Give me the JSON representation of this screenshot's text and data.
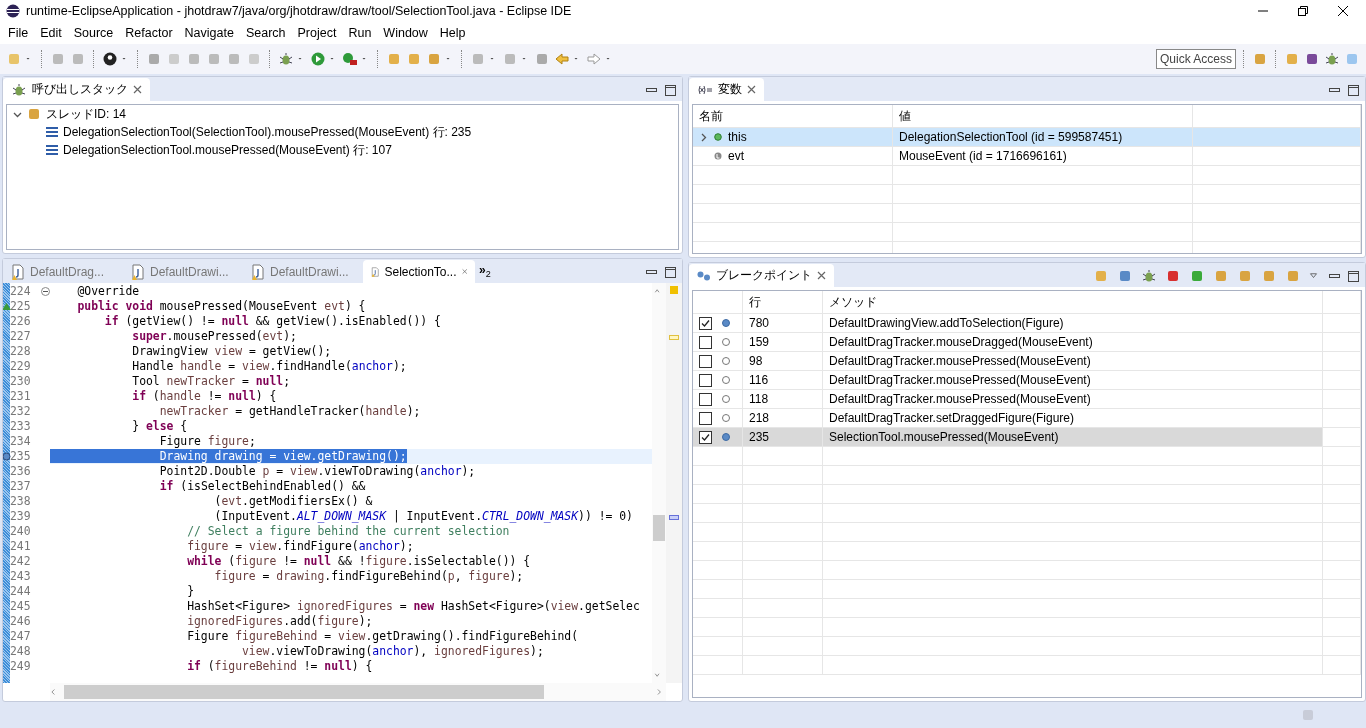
{
  "window": {
    "title": "runtime-EclipseApplication - jhotdraw7/java/org/jhotdraw/draw/tool/SelectionTool.java - Eclipse IDE"
  },
  "menu": [
    "File",
    "Edit",
    "Source",
    "Refactor",
    "Navigate",
    "Search",
    "Project",
    "Run",
    "Window",
    "Help"
  ],
  "quick_access": {
    "placeholder": "Quick Access"
  },
  "call_stack": {
    "title": "呼び出しスタック",
    "thread": {
      "label": "スレッドID: 14",
      "expanded": true,
      "children": [
        {
          "label": "DelegationSelectionTool(SelectionTool).mousePressed(MouseEvent) 行: 235"
        },
        {
          "label": "DelegationSelectionTool.mousePressed(MouseEvent) 行: 107"
        }
      ]
    }
  },
  "variables": {
    "title": "変数",
    "columns": [
      "名前",
      "値"
    ],
    "rows": [
      {
        "name": "this",
        "value": "DelegationSelectionTool (id = 599587451)",
        "kind": "field",
        "expandable": true,
        "selected": true
      },
      {
        "name": "evt",
        "value": "MouseEvent (id = 1716696161)",
        "kind": "local",
        "expandable": false,
        "selected": false
      }
    ]
  },
  "editor": {
    "tabs": [
      {
        "label": "DefaultDrag...",
        "selected": false,
        "warning": true
      },
      {
        "label": "DefaultDrawi...",
        "selected": false,
        "warning": true
      },
      {
        "label": "DefaultDrawi...",
        "selected": false,
        "warning": true
      },
      {
        "label": "SelectionTo...",
        "selected": true,
        "warning": true
      }
    ],
    "overflow": {
      "chevron": "»",
      "count": "2"
    },
    "lines": [
      {
        "number": "224",
        "fold": true,
        "override": false,
        "breakpoint": false,
        "current": false,
        "tokens": [
          {
            "text": "    @Override",
            "kind": "plain"
          }
        ]
      },
      {
        "number": "225",
        "fold": false,
        "override": true,
        "breakpoint": false,
        "current": false,
        "tokens": [
          {
            "text": "    public void",
            "kind": "kw"
          },
          {
            "text": " mousePressed(MouseEvent ",
            "kind": "plain"
          },
          {
            "text": "evt",
            "kind": "var"
          },
          {
            "text": ") {",
            "kind": "plain"
          }
        ]
      },
      {
        "number": "226",
        "fold": false,
        "override": false,
        "breakpoint": false,
        "current": false,
        "tokens": [
          {
            "text": "        if",
            "kind": "kw"
          },
          {
            "text": " (getView() != ",
            "kind": "plain"
          },
          {
            "text": "null",
            "kind": "kw"
          },
          {
            "text": " && getView().isEnabled()) {",
            "kind": "plain"
          }
        ]
      },
      {
        "number": "227",
        "fold": false,
        "override": false,
        "breakpoint": false,
        "current": false,
        "tokens": [
          {
            "text": "            super",
            "kind": "kw"
          },
          {
            "text": ".mousePressed(",
            "kind": "plain"
          },
          {
            "text": "evt",
            "kind": "var"
          },
          {
            "text": ");",
            "kind": "plain"
          }
        ]
      },
      {
        "number": "228",
        "fold": false,
        "override": false,
        "breakpoint": false,
        "current": false,
        "tokens": [
          {
            "text": "            DrawingView ",
            "kind": "plain"
          },
          {
            "text": "view",
            "kind": "var"
          },
          {
            "text": " = getView();",
            "kind": "plain"
          }
        ]
      },
      {
        "number": "229",
        "fold": false,
        "override": false,
        "breakpoint": false,
        "current": false,
        "tokens": [
          {
            "text": "            Handle ",
            "kind": "plain"
          },
          {
            "text": "handle",
            "kind": "var"
          },
          {
            "text": " = ",
            "kind": "plain"
          },
          {
            "text": "view",
            "kind": "var"
          },
          {
            "text": ".findHandle(",
            "kind": "plain"
          },
          {
            "text": "anchor",
            "kind": "field"
          },
          {
            "text": ");",
            "kind": "plain"
          }
        ]
      },
      {
        "number": "230",
        "fold": false,
        "override": false,
        "breakpoint": false,
        "current": false,
        "tokens": [
          {
            "text": "            Tool ",
            "kind": "plain"
          },
          {
            "text": "newTracker",
            "kind": "var"
          },
          {
            "text": " = ",
            "kind": "plain"
          },
          {
            "text": "null",
            "kind": "kw"
          },
          {
            "text": ";",
            "kind": "plain"
          }
        ]
      },
      {
        "number": "231",
        "fold": false,
        "override": false,
        "breakpoint": false,
        "current": false,
        "tokens": [
          {
            "text": "            if",
            "kind": "kw"
          },
          {
            "text": " (",
            "kind": "plain"
          },
          {
            "text": "handle",
            "kind": "var"
          },
          {
            "text": " != ",
            "kind": "plain"
          },
          {
            "text": "null",
            "kind": "kw"
          },
          {
            "text": ") {",
            "kind": "plain"
          }
        ]
      },
      {
        "number": "232",
        "fold": false,
        "override": false,
        "breakpoint": false,
        "current": false,
        "tokens": [
          {
            "text": "                newTracker",
            "kind": "var"
          },
          {
            "text": " = getHandleTracker(",
            "kind": "plain"
          },
          {
            "text": "handle",
            "kind": "var"
          },
          {
            "text": ");",
            "kind": "plain"
          }
        ]
      },
      {
        "number": "233",
        "fold": false,
        "override": false,
        "breakpoint": false,
        "current": false,
        "tokens": [
          {
            "text": "            } ",
            "kind": "plain"
          },
          {
            "text": "else",
            "kind": "kw"
          },
          {
            "text": " {",
            "kind": "plain"
          }
        ]
      },
      {
        "number": "234",
        "fold": false,
        "override": false,
        "breakpoint": false,
        "current": false,
        "tokens": [
          {
            "text": "                Figure ",
            "kind": "plain"
          },
          {
            "text": "figure",
            "kind": "var"
          },
          {
            "text": ";",
            "kind": "plain"
          }
        ]
      },
      {
        "number": "235",
        "fold": false,
        "override": false,
        "breakpoint": true,
        "current": true,
        "tokens": [
          {
            "text": "                Drawing drawing = view.getDrawing();",
            "kind": "plain"
          }
        ]
      },
      {
        "number": "236",
        "fold": false,
        "override": false,
        "breakpoint": false,
        "current": false,
        "tokens": [
          {
            "text": "                Point2D.Double ",
            "kind": "plain"
          },
          {
            "text": "p",
            "kind": "var"
          },
          {
            "text": " = ",
            "kind": "plain"
          },
          {
            "text": "view",
            "kind": "var"
          },
          {
            "text": ".viewToDrawing(",
            "kind": "plain"
          },
          {
            "text": "anchor",
            "kind": "field"
          },
          {
            "text": ");",
            "kind": "plain"
          }
        ]
      },
      {
        "number": "237",
        "fold": false,
        "override": false,
        "breakpoint": false,
        "current": false,
        "tokens": [
          {
            "text": "                if",
            "kind": "kw"
          },
          {
            "text": " (isSelectBehindEnabled() &&",
            "kind": "plain"
          }
        ]
      },
      {
        "number": "238",
        "fold": false,
        "override": false,
        "breakpoint": false,
        "current": false,
        "tokens": [
          {
            "text": "                        (",
            "kind": "plain"
          },
          {
            "text": "evt",
            "kind": "var"
          },
          {
            "text": ".getModifiersEx() &",
            "kind": "plain"
          }
        ]
      },
      {
        "number": "239",
        "fold": false,
        "override": false,
        "breakpoint": false,
        "current": false,
        "tokens": [
          {
            "text": "                        (InputEvent.",
            "kind": "plain"
          },
          {
            "text": "ALT_DOWN_MASK",
            "kind": "const"
          },
          {
            "text": " | InputEvent.",
            "kind": "plain"
          },
          {
            "text": "CTRL_DOWN_MASK",
            "kind": "const"
          },
          {
            "text": ")) != 0)",
            "kind": "plain"
          }
        ]
      },
      {
        "number": "240",
        "fold": false,
        "override": false,
        "breakpoint": false,
        "current": false,
        "tokens": [
          {
            "text": "                    // Select a figure behind the current selection",
            "kind": "comment"
          }
        ]
      },
      {
        "number": "241",
        "fold": false,
        "override": false,
        "breakpoint": false,
        "current": false,
        "tokens": [
          {
            "text": "                    figure",
            "kind": "var"
          },
          {
            "text": " = ",
            "kind": "plain"
          },
          {
            "text": "view",
            "kind": "var"
          },
          {
            "text": ".findFigure(",
            "kind": "plain"
          },
          {
            "text": "anchor",
            "kind": "field"
          },
          {
            "text": ");",
            "kind": "plain"
          }
        ]
      },
      {
        "number": "242",
        "fold": false,
        "override": false,
        "breakpoint": false,
        "current": false,
        "tokens": [
          {
            "text": "                    while",
            "kind": "kw"
          },
          {
            "text": " (",
            "kind": "plain"
          },
          {
            "text": "figure",
            "kind": "var"
          },
          {
            "text": " != ",
            "kind": "plain"
          },
          {
            "text": "null",
            "kind": "kw"
          },
          {
            "text": " && !",
            "kind": "plain"
          },
          {
            "text": "figure",
            "kind": "var"
          },
          {
            "text": ".isSelectable()) {",
            "kind": "plain"
          }
        ]
      },
      {
        "number": "243",
        "fold": false,
        "override": false,
        "breakpoint": false,
        "current": false,
        "tokens": [
          {
            "text": "                        figure",
            "kind": "var"
          },
          {
            "text": " = ",
            "kind": "plain"
          },
          {
            "text": "drawing",
            "kind": "var"
          },
          {
            "text": ".findFigureBehind(",
            "kind": "plain"
          },
          {
            "text": "p",
            "kind": "var"
          },
          {
            "text": ", ",
            "kind": "plain"
          },
          {
            "text": "figure",
            "kind": "var"
          },
          {
            "text": ");",
            "kind": "plain"
          }
        ]
      },
      {
        "number": "244",
        "fold": false,
        "override": false,
        "breakpoint": false,
        "current": false,
        "tokens": [
          {
            "text": "                    }",
            "kind": "plain"
          }
        ]
      },
      {
        "number": "245",
        "fold": false,
        "override": false,
        "breakpoint": false,
        "current": false,
        "tokens": [
          {
            "text": "                    HashSet<Figure> ",
            "kind": "plain"
          },
          {
            "text": "ignoredFigures",
            "kind": "var"
          },
          {
            "text": " = ",
            "kind": "plain"
          },
          {
            "text": "new",
            "kind": "kw"
          },
          {
            "text": " HashSet<Figure>(",
            "kind": "plain"
          },
          {
            "text": "view",
            "kind": "var"
          },
          {
            "text": ".getSelec",
            "kind": "plain"
          }
        ]
      },
      {
        "number": "246",
        "fold": false,
        "override": false,
        "breakpoint": false,
        "current": false,
        "tokens": [
          {
            "text": "                    ignoredFigures",
            "kind": "var"
          },
          {
            "text": ".add(",
            "kind": "plain"
          },
          {
            "text": "figure",
            "kind": "var"
          },
          {
            "text": ");",
            "kind": "plain"
          }
        ]
      },
      {
        "number": "247",
        "fold": false,
        "override": false,
        "breakpoint": false,
        "current": false,
        "tokens": [
          {
            "text": "                    Figure ",
            "kind": "plain"
          },
          {
            "text": "figureBehind",
            "kind": "var"
          },
          {
            "text": " = ",
            "kind": "plain"
          },
          {
            "text": "view",
            "kind": "var"
          },
          {
            "text": ".getDrawing().findFigureBehind(",
            "kind": "plain"
          }
        ]
      },
      {
        "number": "248",
        "fold": false,
        "override": false,
        "breakpoint": false,
        "current": false,
        "tokens": [
          {
            "text": "                            view",
            "kind": "var"
          },
          {
            "text": ".viewToDrawing(",
            "kind": "plain"
          },
          {
            "text": "anchor",
            "kind": "field"
          },
          {
            "text": "), ",
            "kind": "plain"
          },
          {
            "text": "ignoredFigures",
            "kind": "var"
          },
          {
            "text": ");",
            "kind": "plain"
          }
        ]
      },
      {
        "number": "249",
        "fold": false,
        "override": false,
        "breakpoint": false,
        "current": false,
        "tokens": [
          {
            "text": "                    if",
            "kind": "kw"
          },
          {
            "text": " (",
            "kind": "plain"
          },
          {
            "text": "figureBehind",
            "kind": "var"
          },
          {
            "text": " != ",
            "kind": "plain"
          },
          {
            "text": "null",
            "kind": "kw"
          },
          {
            "text": ") {",
            "kind": "plain"
          }
        ]
      }
    ]
  },
  "breakpoints": {
    "title": "ブレークポイント",
    "columns": [
      "行",
      "メソッド"
    ],
    "rows": [
      {
        "line": "780",
        "method": "DefaultDrawingView.addToSelection(Figure)",
        "checked": true,
        "selected": false
      },
      {
        "line": "159",
        "method": "DefaultDragTracker.mouseDragged(MouseEvent)",
        "checked": false,
        "selected": false
      },
      {
        "line": "98",
        "method": "DefaultDragTracker.mousePressed(MouseEvent)",
        "checked": false,
        "selected": false
      },
      {
        "line": "116",
        "method": "DefaultDragTracker.mousePressed(MouseEvent)",
        "checked": false,
        "selected": false
      },
      {
        "line": "118",
        "method": "DefaultDragTracker.mousePressed(MouseEvent)",
        "checked": false,
        "selected": false
      },
      {
        "line": "218",
        "method": "DefaultDragTracker.setDraggedFigure(Figure)",
        "checked": false,
        "selected": false
      },
      {
        "line": "235",
        "method": "SelectionTool.mousePressed(MouseEvent)",
        "checked": true,
        "selected": true
      }
    ]
  }
}
